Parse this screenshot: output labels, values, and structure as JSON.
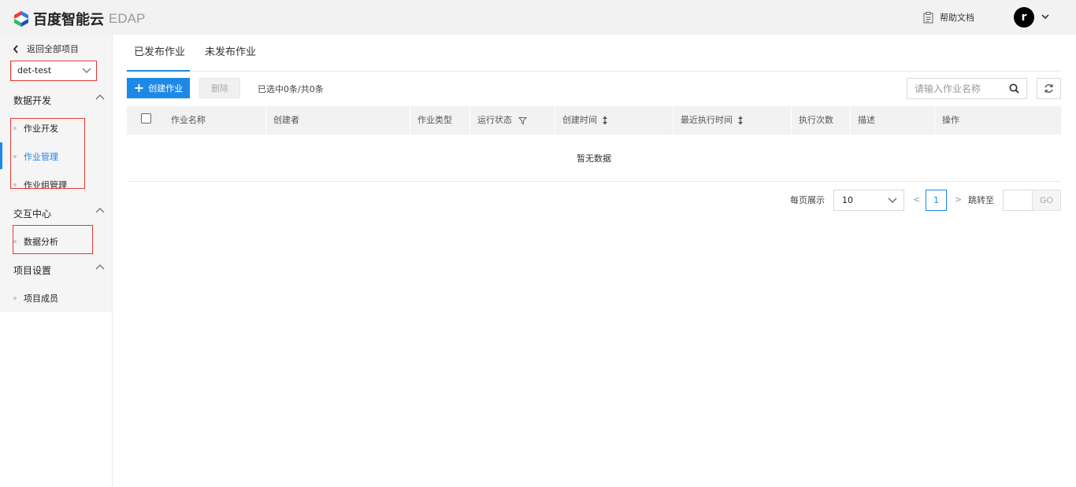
{
  "header": {
    "brand": "百度智能云",
    "product": "EDAP",
    "help_label": "帮助文档",
    "avatar_letter": "r"
  },
  "sidebar": {
    "back_label": "返回全部项目",
    "project_select": "det-test",
    "groups": [
      {
        "title": "数据开发",
        "items": [
          "作业开发",
          "作业管理",
          "作业组管理"
        ]
      },
      {
        "title": "交互中心",
        "items": [
          "数据分析"
        ]
      },
      {
        "title": "项目设置",
        "items": [
          "项目成员"
        ]
      }
    ],
    "active_item": "作业管理"
  },
  "tabs": [
    {
      "label": "已发布作业",
      "active": true
    },
    {
      "label": "未发布作业",
      "active": false
    }
  ],
  "toolbar": {
    "create_label": "创建作业",
    "delete_label": "删除",
    "selection_text": "已选中0条/共0条",
    "search_placeholder": "请输入作业名称"
  },
  "table": {
    "columns": [
      "作业名称",
      "创建者",
      "作业类型",
      "运行状态",
      "创建时间",
      "最近执行时间",
      "执行次数",
      "描述",
      "操作"
    ],
    "empty_text": "暂无数据"
  },
  "pagination": {
    "per_page_label": "每页展示",
    "page_size": "10",
    "prev": "<",
    "current_page": "1",
    "next": ">",
    "jump_label": "跳转至",
    "go_label": "GO"
  },
  "colors": {
    "accent": "#1e88e5",
    "highlight_box": "#e53935"
  }
}
